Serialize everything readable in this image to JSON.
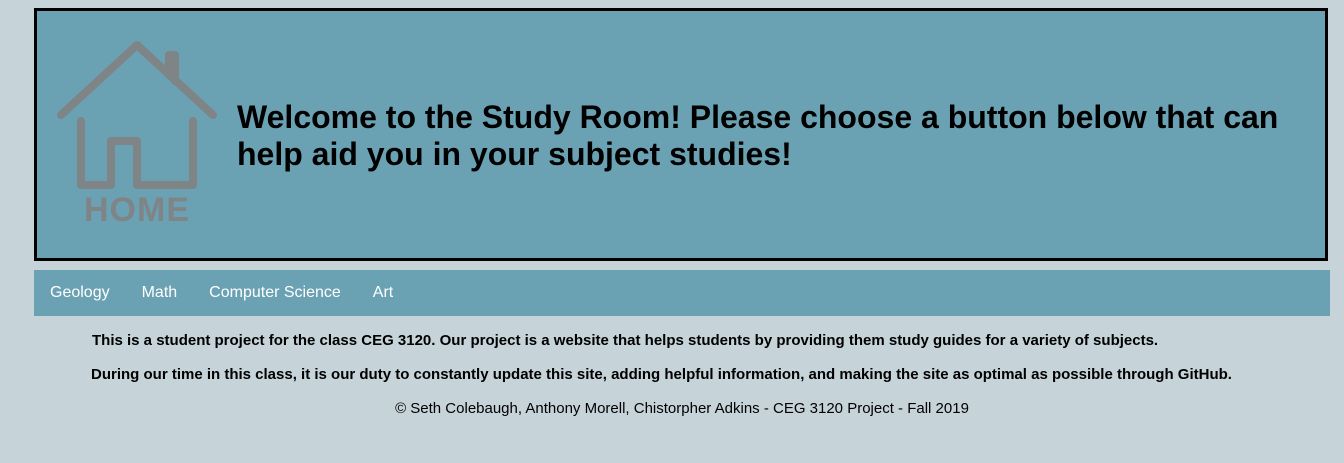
{
  "header": {
    "logo": {
      "icon": "house-icon",
      "label": "HOME",
      "color": "#7f8486"
    },
    "welcome": "Welcome to the Study Room! Please choose a button below that can help aid you in your subject studies!",
    "background": "#6aa2b4"
  },
  "nav": {
    "items": [
      {
        "label": "Geology"
      },
      {
        "label": "Math"
      },
      {
        "label": "Computer Science"
      },
      {
        "label": "Art"
      }
    ]
  },
  "content": {
    "paragraph1": "This is a student project for the class CEG 3120. Our project is a website that helps students by providing them study guides for a variety of subjects.",
    "paragraph2": "During our time in this class, it is our duty to constantly update this site, adding helpful information, and making the site as optimal as possible through GitHub.",
    "copyright": "© Seth Colebaugh, Anthony Morell, Chistorpher Adkins - CEG 3120 Project - Fall 2019"
  }
}
